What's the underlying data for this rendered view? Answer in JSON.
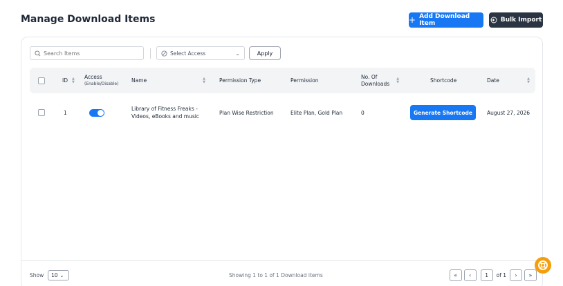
{
  "header": {
    "title": "Manage Download Items",
    "add_label": "Add Download Item",
    "bulk_label": "Bulk Import"
  },
  "filters": {
    "search_placeholder": "Search Items",
    "select_access": "Select Access",
    "apply_label": "Apply"
  },
  "table": {
    "columns": {
      "id": "ID",
      "access": "Access",
      "access_sub": "(Enable/Disable)",
      "name": "Name",
      "permission_type": "Permission Type",
      "permission": "Permission",
      "downloads_1": "No. Of",
      "downloads_2": "Downloads",
      "shortcode": "Shortcode",
      "date": "Date"
    },
    "rows": [
      {
        "id": "1",
        "access_enabled": true,
        "name_1": "Library of Fitness Freaks -",
        "name_2": "Videos, eBooks and music",
        "permission_type": "Plan Wise Restriction",
        "permission": "Elite Plan, Gold Plan",
        "downloads": "0",
        "shortcode_label": "Generate Shortcode",
        "date": "August 27, 2026"
      }
    ]
  },
  "footer": {
    "show_label": "Show",
    "per_page": "10",
    "showing_text": "Showing 1 to 1 of 1 Download items",
    "first": "«",
    "prev": "‹",
    "page": "1",
    "of_text": "of 1",
    "next": "›",
    "last": "»"
  },
  "colors": {
    "accent": "#1878f3",
    "dark_button": "#2b3443",
    "help_fab": "#f59e0b"
  }
}
